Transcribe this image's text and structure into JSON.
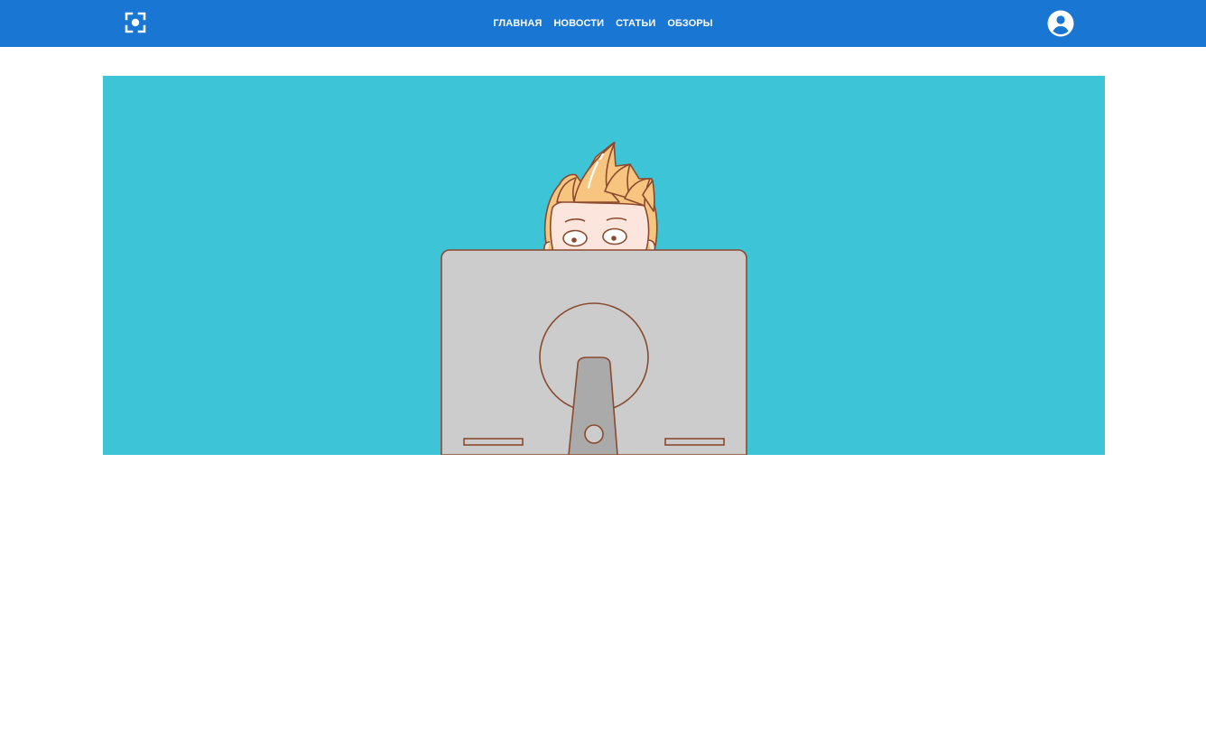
{
  "header": {
    "logo_icon": "focus-camera-icon",
    "nav": [
      {
        "label": "ГЛАВНАЯ"
      },
      {
        "label": "НОВОСТИ"
      },
      {
        "label": "СТАТЬИ"
      },
      {
        "label": "ОБЗОРЫ"
      }
    ],
    "account_icon": "account-circle-icon"
  },
  "colors": {
    "header_bg": "#1976d2",
    "hero_bg": "#3dc4d7",
    "monitor_fill": "#cccccc",
    "outline": "#8a4a2e",
    "hair": "#f7c57f",
    "skin": "#fbe5dc"
  }
}
